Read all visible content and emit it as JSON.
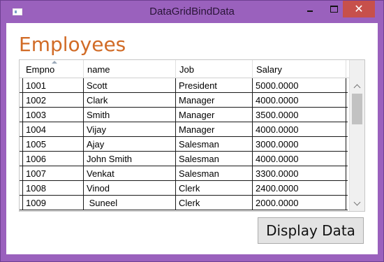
{
  "window": {
    "title": "DataGridBindData",
    "icons": {
      "app": "window-app-icon",
      "minimize": "minimize-icon",
      "maximize": "maximize-icon",
      "close": "close-icon"
    },
    "close_glyph": "✕"
  },
  "colors": {
    "frame": "#9a61bd",
    "heading": "#d16b26",
    "close": "#c7504b"
  },
  "heading": "Employees",
  "grid": {
    "columns": [
      "Empno",
      "name",
      "Job",
      "Salary"
    ],
    "sorted_column": "Empno",
    "rows": [
      [
        "1001",
        "Scott",
        "President",
        "5000.0000"
      ],
      [
        "1002",
        "Clark",
        "Manager",
        "4000.0000"
      ],
      [
        "1003",
        "Smith",
        "Manager",
        "3500.0000"
      ],
      [
        "1004",
        "Vijay",
        "Manager",
        "4000.0000"
      ],
      [
        "1005",
        "Ajay",
        "Salesman",
        "3000.0000"
      ],
      [
        "1006",
        "John Smith",
        "Salesman",
        "4000.0000"
      ],
      [
        "1007",
        "Venkat",
        "Salesman",
        "3300.0000"
      ],
      [
        "1008",
        "Vinod",
        "Clerk",
        "2400.0000"
      ],
      [
        "1009",
        " Suneel",
        "Clerk",
        "2000.0000"
      ]
    ]
  },
  "button": {
    "label": "Display Data"
  }
}
